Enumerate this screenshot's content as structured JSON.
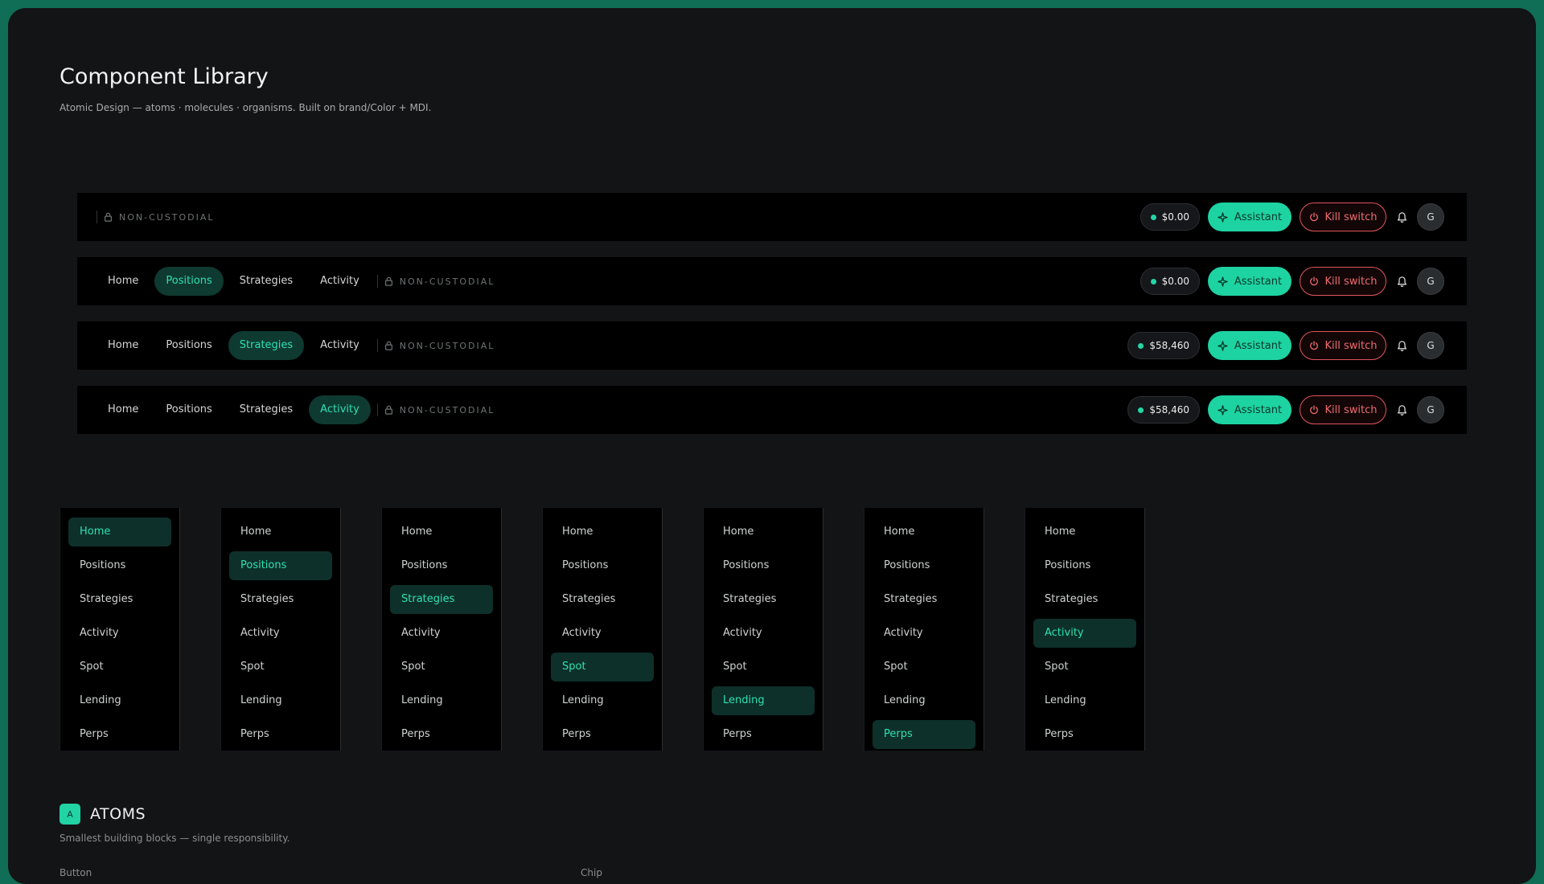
{
  "header": {
    "title": "Component Library",
    "subtitle": "Atomic Design — atoms · molecules · organisms. Built on brand/Color + MDI."
  },
  "accent_color": "#1ed3a2",
  "danger_color": "#e0565c",
  "navbars": [
    {
      "links": [],
      "active": null,
      "non_custodial": "NON-CUSTODIAL",
      "balance": "$0.00",
      "assistant": "Assistant",
      "kill": "Kill switch",
      "avatar": "G"
    },
    {
      "links": [
        "Home",
        "Positions",
        "Strategies",
        "Activity"
      ],
      "active": "Positions",
      "non_custodial": "NON-CUSTODIAL",
      "balance": "$0.00",
      "assistant": "Assistant",
      "kill": "Kill switch",
      "avatar": "G"
    },
    {
      "links": [
        "Home",
        "Positions",
        "Strategies",
        "Activity"
      ],
      "active": "Strategies",
      "non_custodial": "NON-CUSTODIAL",
      "balance": "$58,460",
      "assistant": "Assistant",
      "kill": "Kill switch",
      "avatar": "G"
    },
    {
      "links": [
        "Home",
        "Positions",
        "Strategies",
        "Activity"
      ],
      "active": "Activity",
      "non_custodial": "NON-CUSTODIAL",
      "balance": "$58,460",
      "assistant": "Assistant",
      "kill": "Kill switch",
      "avatar": "G"
    }
  ],
  "sidebar_items": [
    "Home",
    "Positions",
    "Strategies",
    "Activity",
    "Spot",
    "Lending",
    "Perps"
  ],
  "sidebars_active": [
    "Home",
    "Positions",
    "Strategies",
    "Spot",
    "Lending",
    "Perps",
    "Activity"
  ],
  "atoms": {
    "badge": "A",
    "title": "ATOMS",
    "subtitle": "Smallest building blocks — single responsibility.",
    "button_label": "Button",
    "chip_label": "Chip"
  },
  "icons": {
    "lock": "lock-icon",
    "sparkle": "sparkle-icon",
    "power": "power-icon",
    "bell": "bell-icon"
  }
}
